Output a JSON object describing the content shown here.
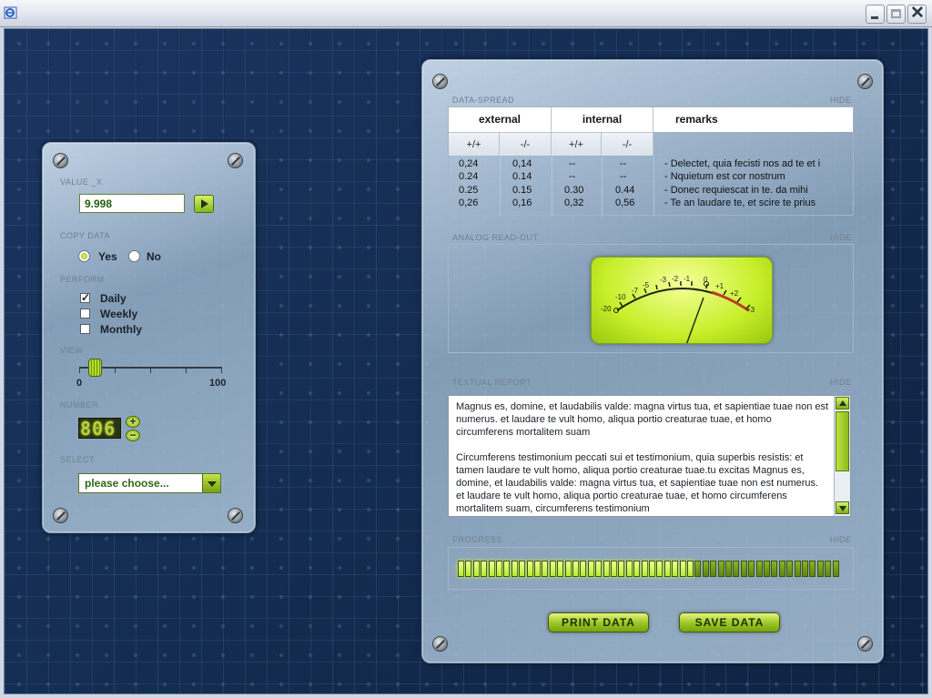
{
  "window": {
    "title": "",
    "buttons": [
      "minimize",
      "maximize",
      "close"
    ]
  },
  "left_panel": {
    "value": {
      "label": "VALUE _X",
      "current": "9.998"
    },
    "copy_data": {
      "label": "COPY DATA",
      "options": [
        "Yes",
        "No"
      ],
      "selected": "Yes"
    },
    "perform": {
      "label": "PERFORM",
      "items": [
        {
          "label": "Daily",
          "checked": true
        },
        {
          "label": "Weekly",
          "checked": false
        },
        {
          "label": "Monthly",
          "checked": false
        }
      ]
    },
    "view": {
      "label": "VIEW",
      "min": "0",
      "max": "100",
      "value": 12
    },
    "number": {
      "label": "NUMBER",
      "value": "806"
    },
    "select": {
      "label": "SELECT",
      "value": "please choose..."
    }
  },
  "right_panel": {
    "data_spread": {
      "label": "DATA-SPREAD",
      "hide": "HIDE",
      "headers": [
        "external",
        "internal",
        "remarks"
      ],
      "subheaders": [
        "+/+",
        "-/-",
        "+/+",
        "-/-"
      ],
      "rows": [
        [
          "0,24",
          "0,14",
          "--",
          "--",
          "- Delectet, quia fecisti nos ad te et i"
        ],
        [
          "0.24",
          "0.14",
          "--",
          "--",
          "- Nquietum est cor nostrum"
        ],
        [
          "0.25",
          "0.15",
          "0.30",
          "0.44",
          "- Donec requiescat in te. da mihi"
        ],
        [
          "0,26",
          "0,16",
          "0,32",
          "0,56",
          "- Te an laudare te, et scire te prius"
        ]
      ]
    },
    "analog": {
      "label": "ANALOG READ-OUT",
      "hide": "HIDE",
      "scale": [
        "-20",
        "-10",
        "-7",
        "-5",
        "-3",
        "-2",
        "-1",
        "0",
        "+1",
        "+2",
        "+3"
      ]
    },
    "report": {
      "label": "TEXTUAL REPORT",
      "hide": "HIDE",
      "paragraph1": "Magnus es, domine, et laudabilis valde: magna virtus tua, et sapientiae tuae non est numerus. et laudare te vult homo, aliqua portio creaturae tuae, et homo circumferens mortalitem suam",
      "paragraph2": "Circumferens testimonium peccati sui et testimonium, quia superbis resistis: et tamen laudare te vult homo, aliqua portio creaturae tuae.tu excitas Magnus es, domine, et laudabilis valde: magna virtus tua, et sapientiae tuae non est numerus. et laudare te vult homo, aliqua portio creaturae tuae, et homo circumferens mortalitem suam, circumferens testimonium"
    },
    "progress": {
      "label": "PROGRESS",
      "hide": "HIDE",
      "value": 0.62
    },
    "buttons": {
      "print": "PRINT DATA",
      "save": "SAVE DATA"
    }
  },
  "colors": {
    "accent": "#9bc523",
    "background": "#152c50",
    "panel": "#a8c0d6"
  }
}
